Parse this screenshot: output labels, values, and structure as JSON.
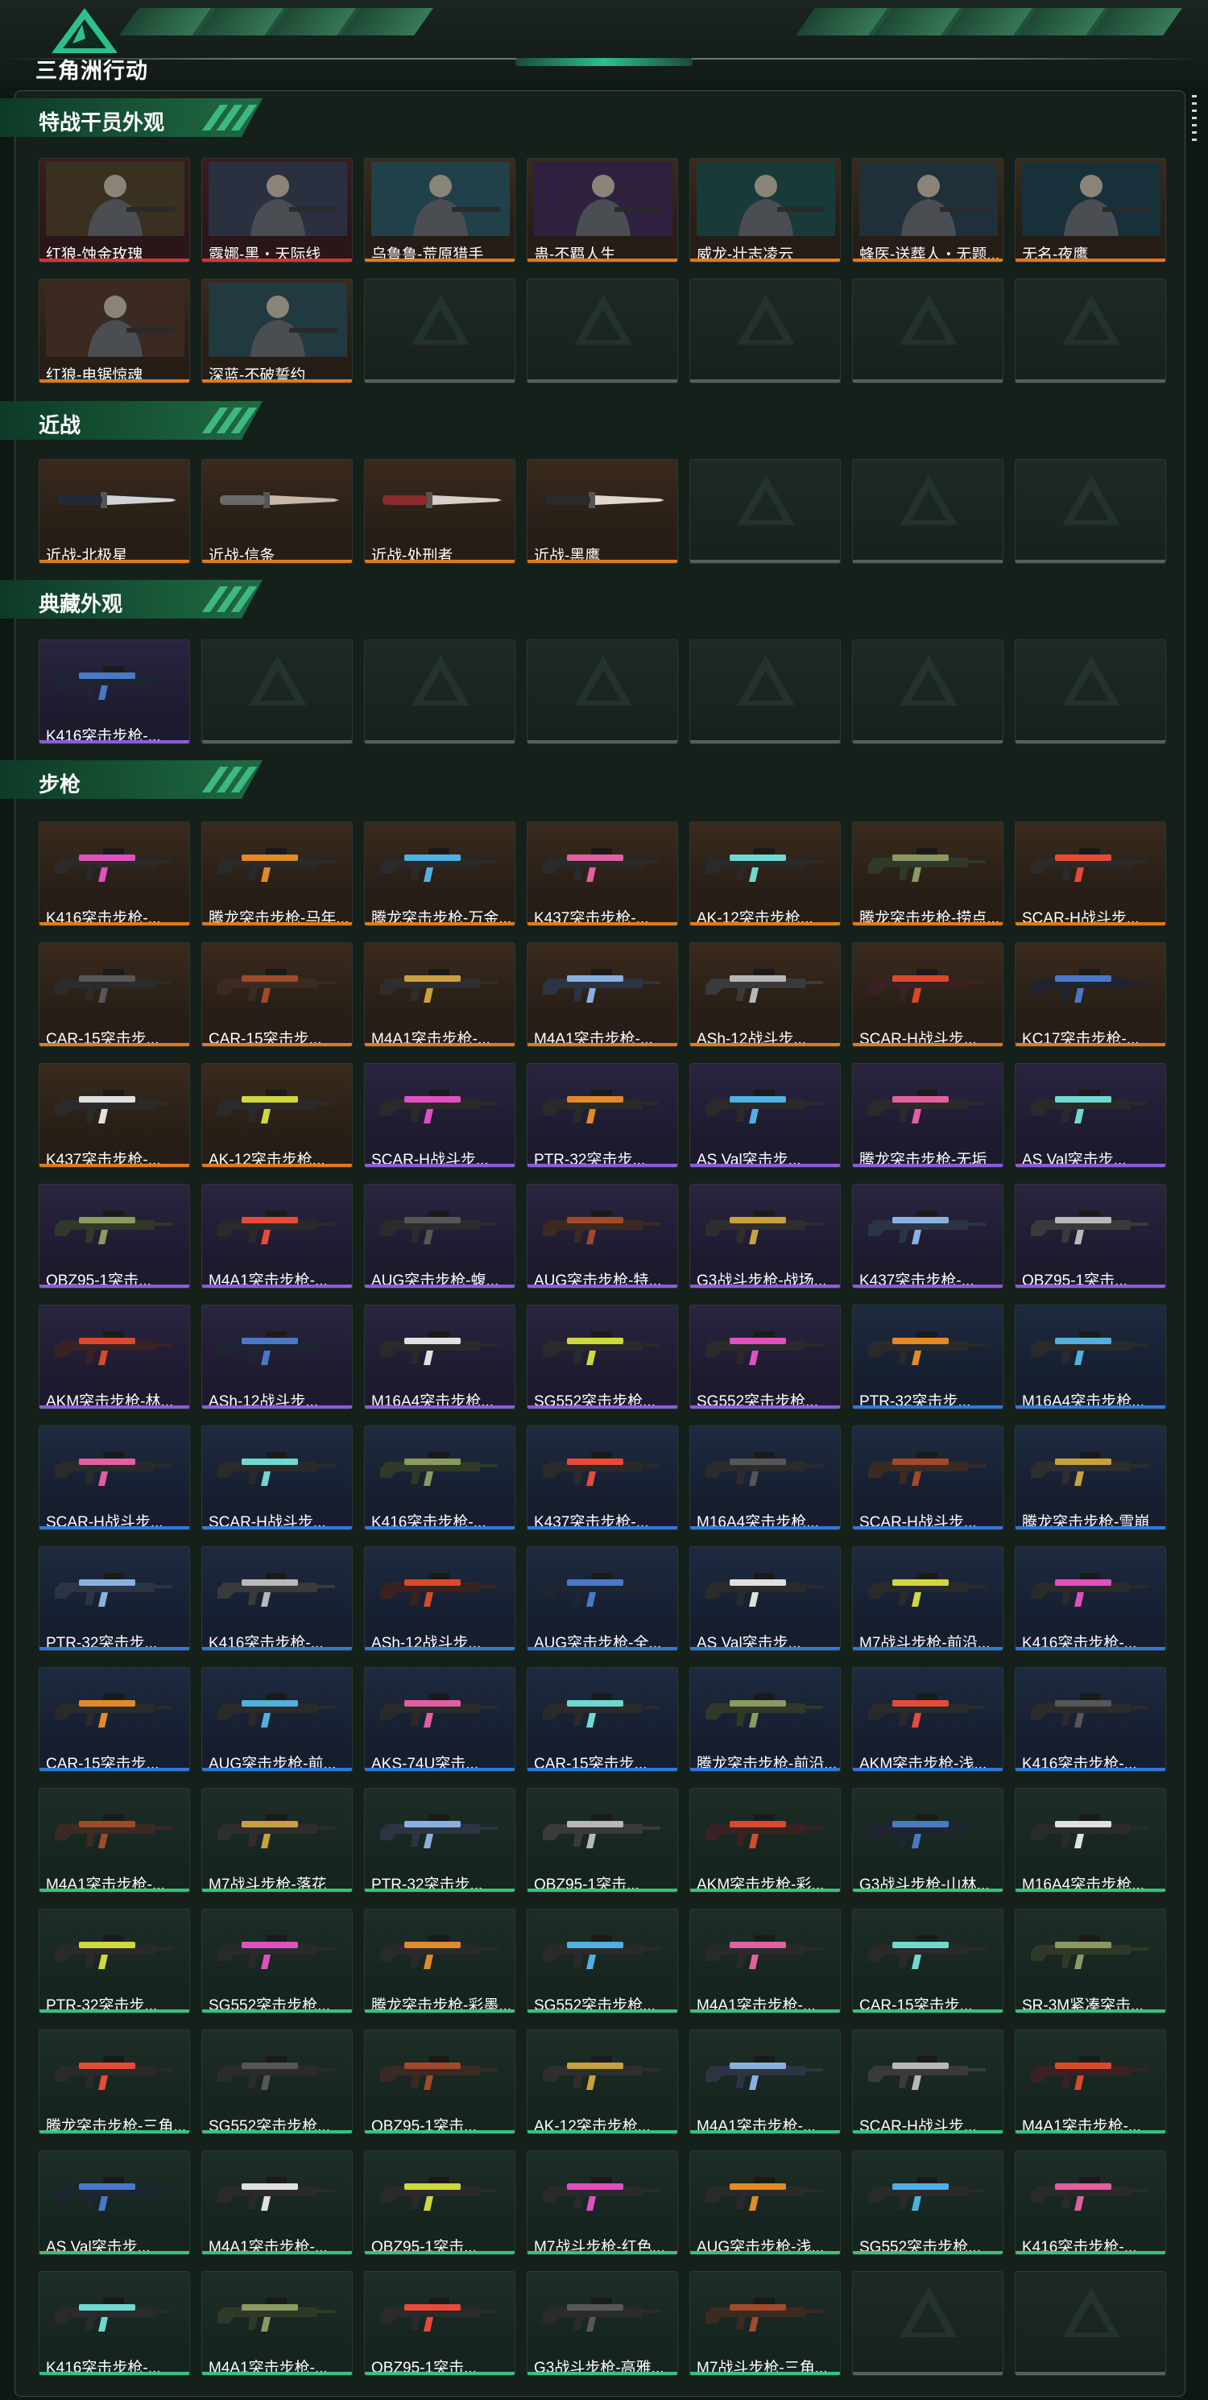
{
  "app": {
    "brand_title": "三角洲行动",
    "colors": {
      "background": "#0f1714",
      "accent": "#2ec08a",
      "rarity_orange": "#e07a1a",
      "rarity_red": "#d8323a",
      "rarity_purple": "#8f5ad8",
      "rarity_blue": "#2f78d8",
      "rarity_green": "#38c27a"
    }
  },
  "sections": [
    {
      "title": "特战干员外观",
      "kind": "operator",
      "items": [
        {
          "label": "红狼-蚀金玫瑰",
          "rarity": "red",
          "caption": "蚀金玫瑰"
        },
        {
          "label": "露娜-黑・天际线",
          "rarity": "red",
          "caption": "天际线"
        },
        {
          "label": "乌鲁鲁-荒原猎手",
          "rarity": "orange",
          "caption": "荒原猎手"
        },
        {
          "label": "蛊-不羁人生",
          "rarity": "orange",
          "caption": "不羁人生"
        },
        {
          "label": "威龙-壮志凌云",
          "rarity": "orange",
          "caption": "壮志凌云"
        },
        {
          "label": "蜂医-送葬人・无题...",
          "rarity": "orange",
          "caption": "送葬人"
        },
        {
          "label": "无名-夜鹰",
          "rarity": "orange",
          "caption": "夜鹰"
        },
        {
          "label": "红狼-电锯惊魂",
          "rarity": "orange",
          "caption": "电锯惊魂"
        },
        {
          "label": "深蓝-不破誓约",
          "rarity": "orange",
          "caption": "不破誓约"
        },
        {
          "label": "",
          "rarity": "empty"
        },
        {
          "label": "",
          "rarity": "empty"
        },
        {
          "label": "",
          "rarity": "empty"
        },
        {
          "label": "",
          "rarity": "empty"
        },
        {
          "label": "",
          "rarity": "empty"
        }
      ]
    },
    {
      "title": "近战",
      "kind": "knife",
      "items": [
        {
          "label": "近战-北极星",
          "rarity": "orange"
        },
        {
          "label": "近战-信条",
          "rarity": "orange"
        },
        {
          "label": "近战-处刑者",
          "rarity": "orange"
        },
        {
          "label": "近战-黑鹰",
          "rarity": "orange"
        },
        {
          "label": "",
          "rarity": "empty"
        },
        {
          "label": "",
          "rarity": "empty"
        },
        {
          "label": "",
          "rarity": "empty"
        }
      ]
    },
    {
      "title": "典藏外观",
      "kind": "gun",
      "items": [
        {
          "label": "K416突击步枪-...",
          "rarity": "purple"
        },
        {
          "label": "",
          "rarity": "empty"
        },
        {
          "label": "",
          "rarity": "empty"
        },
        {
          "label": "",
          "rarity": "empty"
        },
        {
          "label": "",
          "rarity": "empty"
        },
        {
          "label": "",
          "rarity": "empty"
        },
        {
          "label": "",
          "rarity": "empty"
        }
      ]
    },
    {
      "title": "步枪",
      "kind": "gun",
      "items": [
        {
          "label": "K416突击步枪-...",
          "rarity": "orange"
        },
        {
          "label": "腾龙突击步枪-马年...",
          "rarity": "orange"
        },
        {
          "label": "腾龙突击步枪-万金...",
          "rarity": "orange"
        },
        {
          "label": "K437突击步枪-...",
          "rarity": "orange"
        },
        {
          "label": "AK-12突击步枪...",
          "rarity": "orange"
        },
        {
          "label": "腾龙突击步枪-捞点...",
          "rarity": "orange"
        },
        {
          "label": "SCAR-H战斗步...",
          "rarity": "orange"
        },
        {
          "label": "CAR-15突击步...",
          "rarity": "orange"
        },
        {
          "label": "CAR-15突击步...",
          "rarity": "orange"
        },
        {
          "label": "M4A1突击步枪-...",
          "rarity": "orange"
        },
        {
          "label": "M4A1突击步枪-...",
          "rarity": "orange"
        },
        {
          "label": "ASh-12战斗步...",
          "rarity": "orange"
        },
        {
          "label": "SCAR-H战斗步...",
          "rarity": "orange"
        },
        {
          "label": "KC17突击步枪-...",
          "rarity": "orange"
        },
        {
          "label": "K437突击步枪-...",
          "rarity": "orange"
        },
        {
          "label": "AK-12突击步枪...",
          "rarity": "orange"
        },
        {
          "label": "SCAR-H战斗步...",
          "rarity": "purple"
        },
        {
          "label": "PTR-32突击步...",
          "rarity": "purple"
        },
        {
          "label": "AS Val突击步...",
          "rarity": "purple"
        },
        {
          "label": "腾龙突击步枪-无垢",
          "rarity": "purple"
        },
        {
          "label": "AS Val突击步...",
          "rarity": "purple"
        },
        {
          "label": "QBZ95-1突击...",
          "rarity": "purple"
        },
        {
          "label": "M4A1突击步枪-...",
          "rarity": "purple"
        },
        {
          "label": "AUG突击步枪-蝮...",
          "rarity": "purple"
        },
        {
          "label": "AUG突击步枪-特...",
          "rarity": "purple"
        },
        {
          "label": "G3战斗步枪-战场...",
          "rarity": "purple"
        },
        {
          "label": "K437突击步枪-...",
          "rarity": "purple"
        },
        {
          "label": "QBZ95-1突击...",
          "rarity": "purple"
        },
        {
          "label": "AKM突击步枪-林...",
          "rarity": "purple"
        },
        {
          "label": "ASh-12战斗步...",
          "rarity": "purple"
        },
        {
          "label": "M16A4突击步枪...",
          "rarity": "purple"
        },
        {
          "label": "SG552突击步枪...",
          "rarity": "purple"
        },
        {
          "label": "SG552突击步枪...",
          "rarity": "purple"
        },
        {
          "label": "PTR-32突击步...",
          "rarity": "blue"
        },
        {
          "label": "M16A4突击步枪...",
          "rarity": "blue"
        },
        {
          "label": "SCAR-H战斗步...",
          "rarity": "blue"
        },
        {
          "label": "SCAR-H战斗步...",
          "rarity": "blue"
        },
        {
          "label": "K416突击步枪-...",
          "rarity": "blue"
        },
        {
          "label": "K437突击步枪-...",
          "rarity": "blue"
        },
        {
          "label": "M16A4突击步枪...",
          "rarity": "blue"
        },
        {
          "label": "SCAR-H战斗步...",
          "rarity": "blue"
        },
        {
          "label": "腾龙突击步枪-雪崩",
          "rarity": "blue"
        },
        {
          "label": "PTR-32突击步...",
          "rarity": "blue"
        },
        {
          "label": "K416突击步枪-...",
          "rarity": "blue"
        },
        {
          "label": "ASh-12战斗步...",
          "rarity": "blue"
        },
        {
          "label": "AUG突击步枪-全...",
          "rarity": "blue"
        },
        {
          "label": "AS Val突击步...",
          "rarity": "blue"
        },
        {
          "label": "M7战斗步枪-前沿...",
          "rarity": "blue"
        },
        {
          "label": "K416突击步枪-...",
          "rarity": "blue"
        },
        {
          "label": "CAR-15突击步...",
          "rarity": "blue"
        },
        {
          "label": "AUG突击步枪-前...",
          "rarity": "blue"
        },
        {
          "label": "AKS-74U突击...",
          "rarity": "blue"
        },
        {
          "label": "CAR-15突击步...",
          "rarity": "blue"
        },
        {
          "label": "腾龙突击步枪-前沿...",
          "rarity": "blue"
        },
        {
          "label": "AKM突击步枪-浅...",
          "rarity": "blue"
        },
        {
          "label": "K416突击步枪-...",
          "rarity": "blue"
        },
        {
          "label": "M4A1突击步枪-...",
          "rarity": "green"
        },
        {
          "label": "M7战斗步枪-落花",
          "rarity": "green"
        },
        {
          "label": "PTR-32突击步...",
          "rarity": "green"
        },
        {
          "label": "QBZ95-1突击...",
          "rarity": "green"
        },
        {
          "label": "AKM突击步枪-彩...",
          "rarity": "green"
        },
        {
          "label": "G3战斗步枪-山林...",
          "rarity": "green"
        },
        {
          "label": "M16A4突击步枪...",
          "rarity": "green"
        },
        {
          "label": "PTR-32突击步...",
          "rarity": "green"
        },
        {
          "label": "SG552突击步枪...",
          "rarity": "green"
        },
        {
          "label": "腾龙突击步枪-彩墨...",
          "rarity": "green"
        },
        {
          "label": "SG552突击步枪...",
          "rarity": "green"
        },
        {
          "label": "M4A1突击步枪-...",
          "rarity": "green"
        },
        {
          "label": "CAR-15突击步...",
          "rarity": "green"
        },
        {
          "label": "SR-3M紧凑突击...",
          "rarity": "green"
        },
        {
          "label": "腾龙突击步枪-三角...",
          "rarity": "green"
        },
        {
          "label": "SG552突击步枪...",
          "rarity": "green"
        },
        {
          "label": "QBZ95-1突击...",
          "rarity": "green"
        },
        {
          "label": "AK-12突击步枪...",
          "rarity": "green"
        },
        {
          "label": "M4A1突击步枪-...",
          "rarity": "green"
        },
        {
          "label": "SCAR-H战斗步...",
          "rarity": "green"
        },
        {
          "label": "M4A1突击步枪-...",
          "rarity": "green"
        },
        {
          "label": "AS Val突击步...",
          "rarity": "green"
        },
        {
          "label": "M4A1突击步枪-...",
          "rarity": "green"
        },
        {
          "label": "QBZ95-1突击...",
          "rarity": "green"
        },
        {
          "label": "M7战斗步枪-红色...",
          "rarity": "green"
        },
        {
          "label": "AUG突击步枪-浅...",
          "rarity": "green"
        },
        {
          "label": "SG552突击步枪...",
          "rarity": "green"
        },
        {
          "label": "K416突击步枪-...",
          "rarity": "green"
        },
        {
          "label": "K416突击步枪-...",
          "rarity": "green"
        },
        {
          "label": "M4A1突击步枪-...",
          "rarity": "green"
        },
        {
          "label": "QBZ95-1突击...",
          "rarity": "green"
        },
        {
          "label": "G3战斗步枪-高雅...",
          "rarity": "green"
        },
        {
          "label": "M7战斗步枪-三角...",
          "rarity": "green"
        },
        {
          "label": "",
          "rarity": "empty"
        },
        {
          "label": "",
          "rarity": "empty"
        }
      ]
    }
  ]
}
